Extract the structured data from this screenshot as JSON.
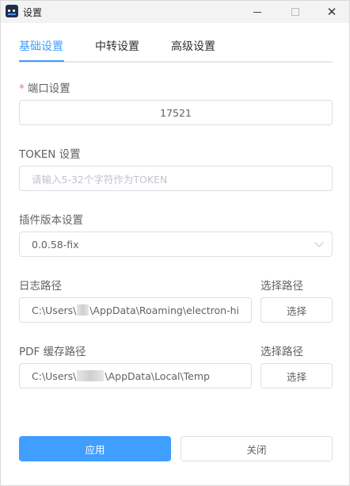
{
  "window": {
    "title": "设置"
  },
  "tabs": [
    {
      "label": "基础设置",
      "active": true
    },
    {
      "label": "中转设置",
      "active": false
    },
    {
      "label": "高级设置",
      "active": false
    }
  ],
  "form": {
    "port": {
      "required_mark": "*",
      "label": "端口设置",
      "value": "17521"
    },
    "token": {
      "label": "TOKEN 设置",
      "placeholder": "请输入5-32个字符作为TOKEN",
      "value": ""
    },
    "plugin_version": {
      "label": "插件版本设置",
      "selected": "0.0.58-fix"
    },
    "log_path": {
      "label": "日志路径",
      "value_prefix": "C:\\Users\\",
      "value_suffix": "\\AppData\\Roaming\\electron-hi",
      "choose_label": "选择路径",
      "choose_button": "选择"
    },
    "pdf_cache_path": {
      "label": "PDF 缓存路径",
      "value_prefix": "C:\\Users\\",
      "value_suffix": "\\AppData\\Local\\Temp",
      "choose_label": "选择路径",
      "choose_button": "选择"
    }
  },
  "footer": {
    "apply_button": "应用",
    "close_button": "关闭"
  },
  "colors": {
    "accent": "#409eff",
    "required": "#f56c6c"
  }
}
